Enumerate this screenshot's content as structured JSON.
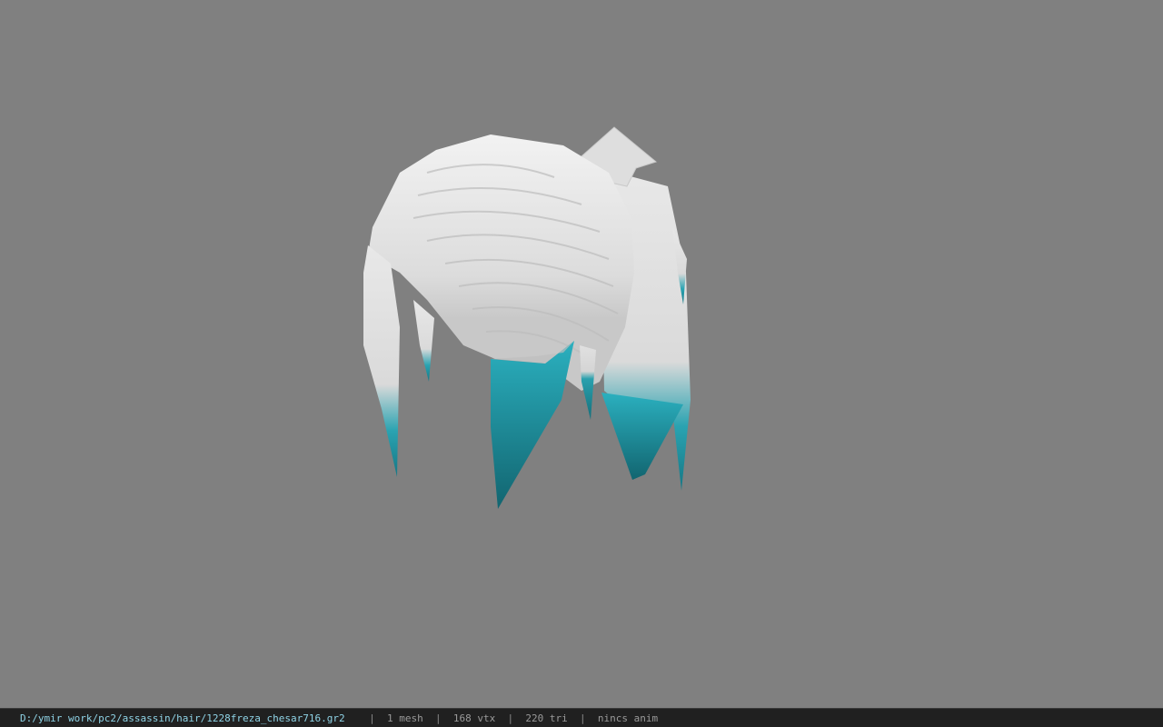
{
  "viewport": {
    "background": "#808080",
    "model": {
      "name": "hair-mesh",
      "base_color": "#e6e6e6",
      "tip_color": "#1c8f9e"
    }
  },
  "status_bar": {
    "path": "D:/ymir work/pc2/assassin/hair/1228freza_chesar716.gr2",
    "separator": "|",
    "mesh": "1 mesh",
    "vtx": "168 vtx",
    "tri": "220 tri",
    "anim": "nincs anim"
  }
}
